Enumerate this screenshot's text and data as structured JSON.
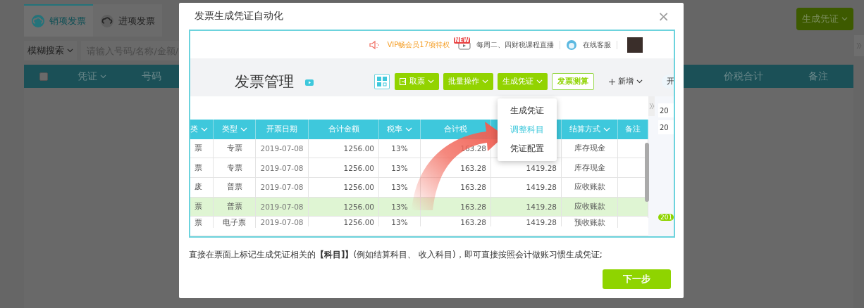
{
  "background": {
    "tabs": [
      {
        "label": "销项发票",
        "selected": true
      },
      {
        "label": "进项发票",
        "selected": false
      }
    ],
    "search": {
      "mode": "模糊搜索",
      "placeholder": "请输入号码/名称/金额/"
    },
    "action_button": "生成凭证",
    "table": {
      "select_all_checked": false,
      "columns": [
        {
          "label": "凭证",
          "dropdown": true
        },
        {
          "label": "号码",
          "dropdown": false
        },
        {
          "label": "价税合计",
          "dropdown": false
        },
        {
          "label": "备注",
          "dropdown": false
        }
      ]
    }
  },
  "dialog": {
    "title": "发票生成凭证自动化",
    "close": "×",
    "preview": {
      "top_bar": {
        "vip": "VIP畅会员17项特权",
        "new_badge": "NEW",
        "live": "每周二、四财税课程直播",
        "service": "在线客服"
      },
      "header": {
        "title": "发票管理",
        "buttons": [
          {
            "label": "取票",
            "kind": "icon_dropdown"
          },
          {
            "label": "批量操作",
            "kind": "dropdown"
          },
          {
            "label": "生成凭证",
            "kind": "dropdown"
          },
          {
            "label": "发票测算",
            "kind": "outline"
          },
          {
            "label": "新增",
            "kind": "add"
          },
          {
            "label": "开",
            "kind": "pill"
          }
        ]
      },
      "menu": {
        "items": [
          {
            "label": "生成凭证",
            "selected": false
          },
          {
            "label": "调整科目",
            "selected": true
          },
          {
            "label": "凭证配置",
            "selected": false
          }
        ]
      },
      "table": {
        "columns": [
          {
            "label": "类",
            "dropdown": true
          },
          {
            "label": "类型",
            "dropdown": true
          },
          {
            "label": "开票日期",
            "dropdown": false
          },
          {
            "label": "合计金额",
            "dropdown": false
          },
          {
            "label": "税率",
            "dropdown": true
          },
          {
            "label": "合计税",
            "dropdown": false
          },
          null,
          {
            "label": "结算方式",
            "dropdown": true
          },
          {
            "label": "备注",
            "dropdown": false
          }
        ],
        "rows": [
          {
            "selected": false,
            "cells": [
              "票",
              "专票",
              "2019-07-08",
              "1256.00",
              "13%",
              "163.28",
              null,
              "库存现金",
              null
            ]
          },
          {
            "selected": false,
            "cells": [
              "票",
              "专票",
              "2019-07-08",
              "1256.00",
              "13%",
              "163.28",
              "1419.28",
              "库存现金",
              null
            ]
          },
          {
            "selected": false,
            "cells": [
              "废",
              "普票",
              "2019-07-08",
              "1256.00",
              "13%",
              "163.28",
              "1419.28",
              "应收账款",
              null
            ]
          },
          {
            "selected": true,
            "cells": [
              "票",
              "普票",
              "2019-07-08",
              "1256.00",
              "13%",
              "163.28",
              "1419.28",
              "应收账款",
              null
            ]
          },
          {
            "selected": false,
            "cells": [
              "票",
              "电子票",
              "2019-07-08",
              "1256.00",
              "13%",
              "163.28",
              "1419.28",
              "预收账款",
              null
            ]
          }
        ]
      },
      "side": {
        "items": [
          "20",
          "20"
        ],
        "badge": "201"
      }
    },
    "description": "直接在票面上标记生成凭证相关的**【科目]】**(例如结算科目、 收入科目)，即可直接按照会计做账习惯生成凭证;",
    "next_button": "下一步"
  }
}
